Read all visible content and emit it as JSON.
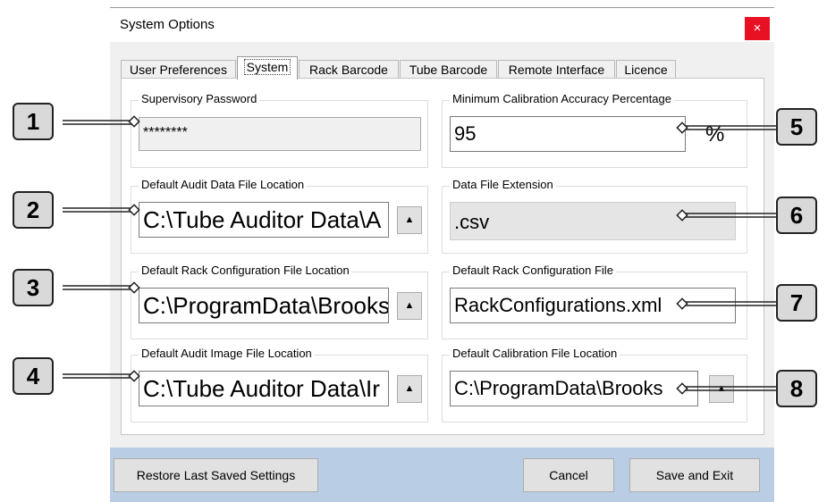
{
  "window": {
    "title": "System Options",
    "close_glyph": "×"
  },
  "tabs": [
    {
      "label": "User Preferences"
    },
    {
      "label": "System"
    },
    {
      "label": "Rack Barcode"
    },
    {
      "label": "Tube Barcode"
    },
    {
      "label": "Remote Interface"
    },
    {
      "label": "Licence"
    }
  ],
  "active_tab": "System",
  "groups": {
    "supervisory_password": {
      "label": "Supervisory Password",
      "value": "********"
    },
    "min_calibration": {
      "label": "Minimum Calibration Accuracy Percentage",
      "value": "95",
      "unit": "%"
    },
    "audit_data_location": {
      "label": "Default Audit Data File Location",
      "value": "C:\\Tube Auditor Data\\A"
    },
    "data_file_extension": {
      "label": "Data File Extension",
      "value": ".csv"
    },
    "rack_config_location": {
      "label": "Default Rack Configuration File Location",
      "value": "C:\\ProgramData\\Brooks"
    },
    "rack_config_file": {
      "label": "Default Rack Configuration File",
      "value": "RackConfigurations.xml"
    },
    "audit_image_location": {
      "label": "Default Audit Image File Location",
      "value": "C:\\Tube Auditor Data\\Ir"
    },
    "calibration_location": {
      "label": "Default Calibration File Location",
      "value": "C:\\ProgramData\\Brooks"
    }
  },
  "browse_glyph": "▲",
  "footer": {
    "restore_label": "Restore Last Saved Settings",
    "cancel_label": "Cancel",
    "save_label": "Save and Exit"
  },
  "callouts": [
    "1",
    "2",
    "3",
    "4",
    "5",
    "6",
    "7",
    "8"
  ],
  "colors": {
    "close": "#e81123",
    "footer": "#b9cde5",
    "callout": "#d9d9d9"
  }
}
